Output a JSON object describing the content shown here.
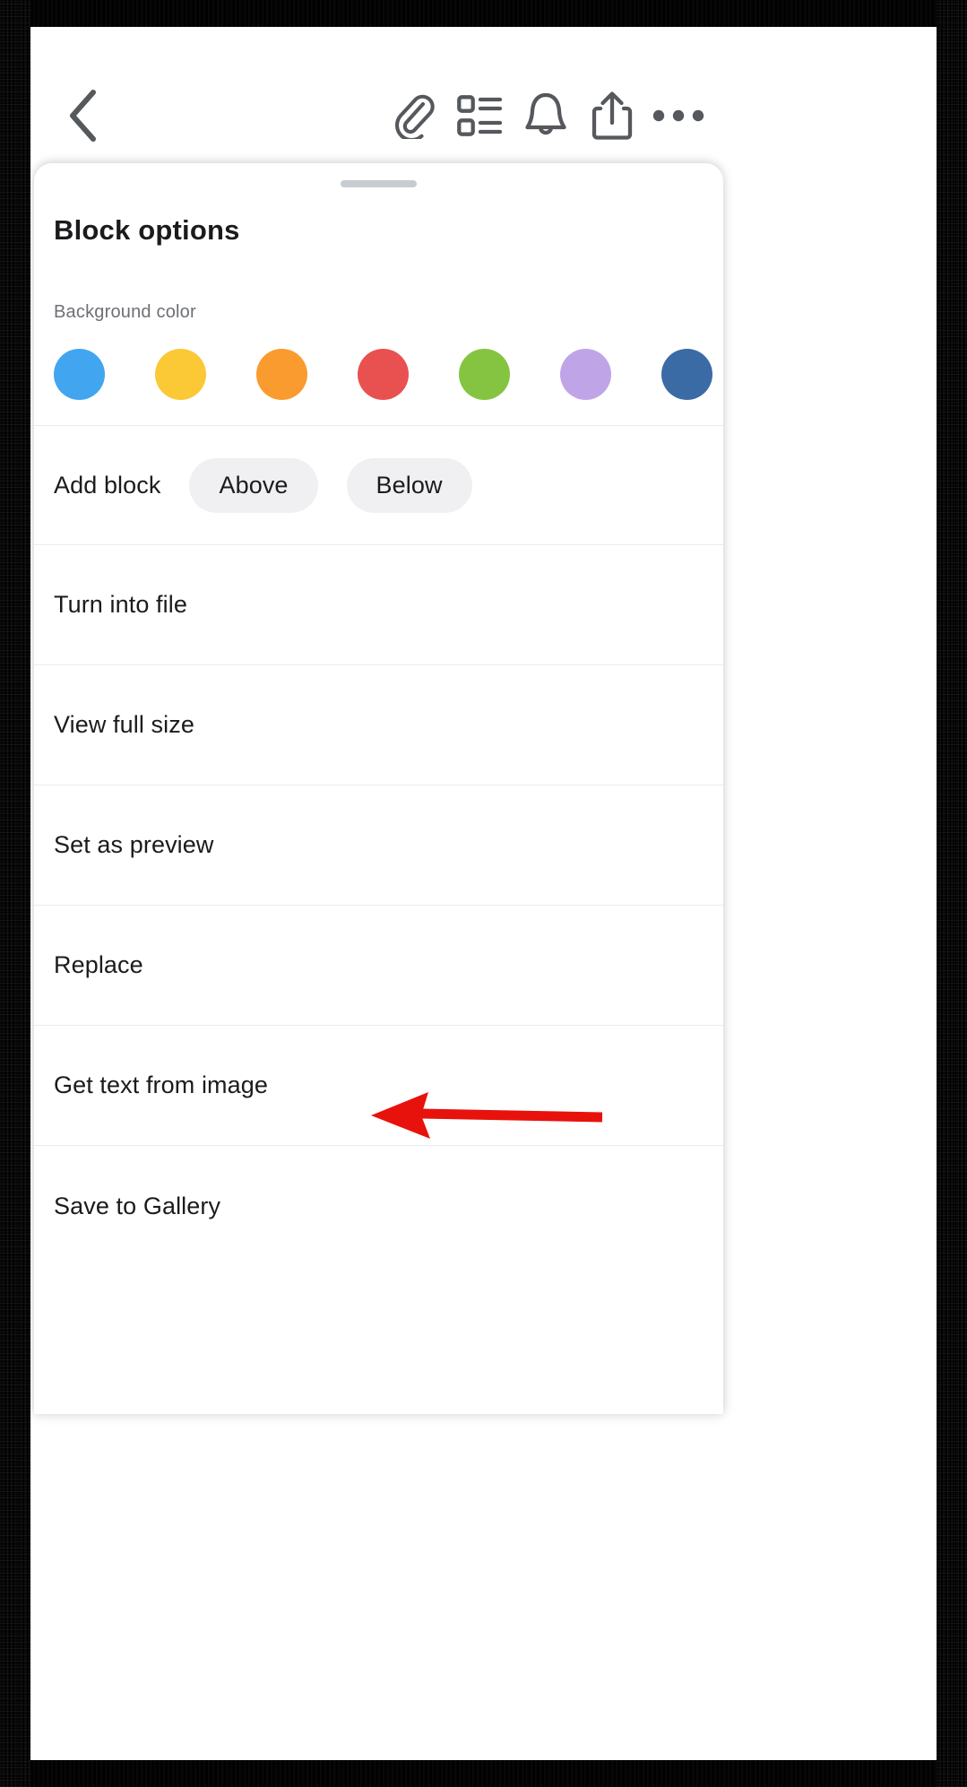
{
  "toolbar": {
    "items": [
      {
        "name": "back-button",
        "icon": "chevron-left-icon"
      },
      {
        "name": "attachment-button",
        "icon": "paperclip-icon"
      },
      {
        "name": "list-view-button",
        "icon": "list-icon"
      },
      {
        "name": "notifications-button",
        "icon": "bell-icon"
      },
      {
        "name": "share-button",
        "icon": "share-icon"
      },
      {
        "name": "more-button",
        "icon": "ellipsis-icon"
      }
    ]
  },
  "sheet": {
    "title": "Block options",
    "background_color": {
      "label": "Background color",
      "swatches": [
        {
          "name": "blue",
          "hex": "#41A5F0"
        },
        {
          "name": "yellow",
          "hex": "#FBC836"
        },
        {
          "name": "orange",
          "hex": "#F99B2E"
        },
        {
          "name": "red",
          "hex": "#E8514F"
        },
        {
          "name": "green",
          "hex": "#85C440"
        },
        {
          "name": "purple",
          "hex": "#BFA5E8"
        },
        {
          "name": "dark-blue",
          "hex": "#3B6BA5"
        }
      ]
    },
    "add_block": {
      "label": "Add block",
      "above_label": "Above",
      "below_label": "Below"
    },
    "menu_items": [
      {
        "label": "Turn into file"
      },
      {
        "label": "View full size"
      },
      {
        "label": "Set as preview"
      },
      {
        "label": "Replace"
      },
      {
        "label": "Get text from image"
      },
      {
        "label": "Save to Gallery"
      }
    ]
  },
  "annotation": {
    "arrow_color": "#E8120C",
    "points_to": "Get text from image"
  }
}
